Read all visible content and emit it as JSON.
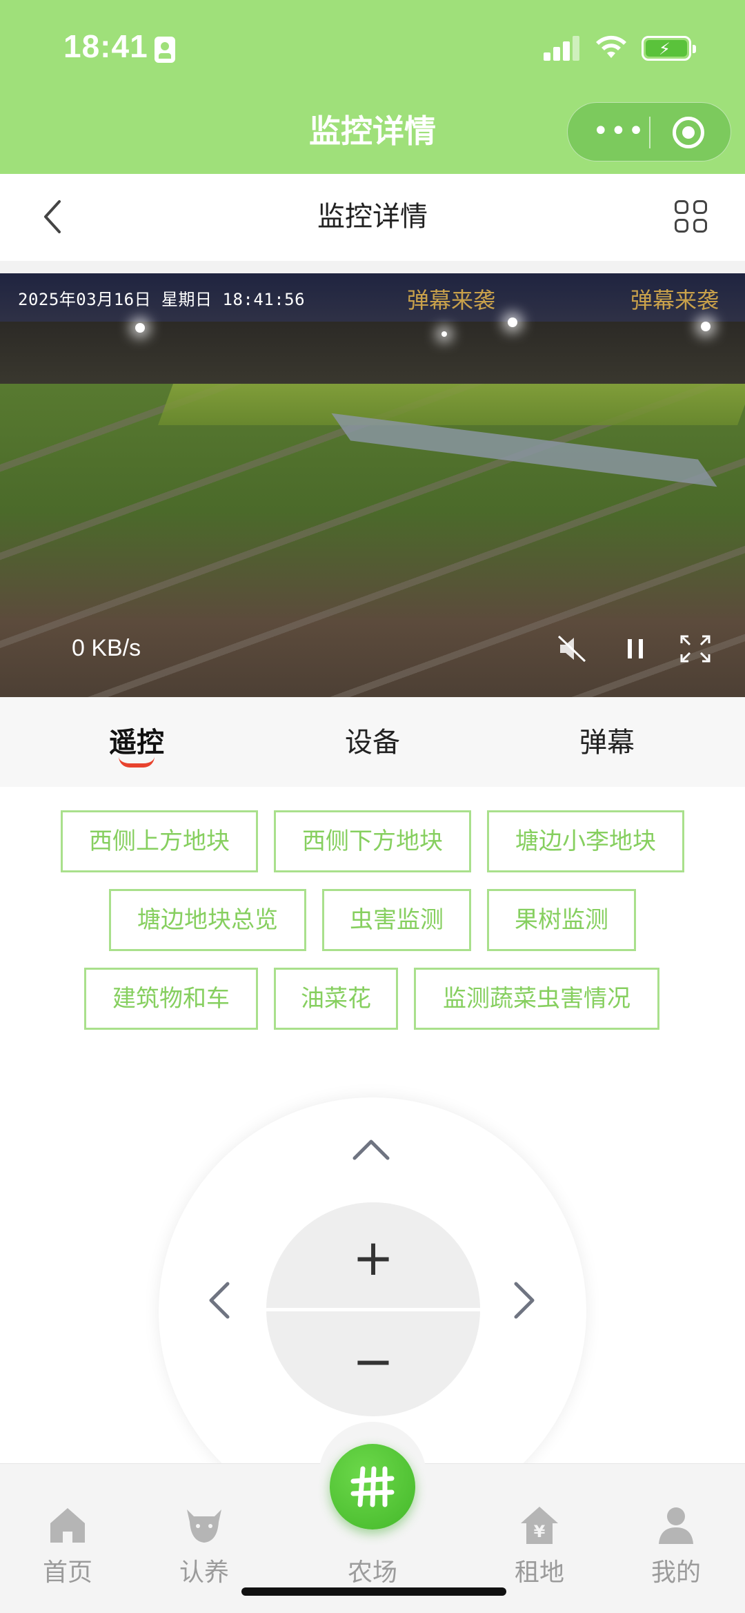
{
  "status_bar": {
    "time": "18:41"
  },
  "miniprogram": {
    "title": "监控详情",
    "capsule_more_icon": "more-dots-icon",
    "capsule_close_icon": "target-circle-icon"
  },
  "header": {
    "title": "监控详情",
    "back_icon": "chevron-left-icon",
    "menu_icon": "grid-four-icon"
  },
  "video": {
    "timestamp": "2025年03月16日  星期日  18:41:56",
    "danmu": [
      "弹幕来袭",
      "弹幕来袭"
    ],
    "speed": "0 KB/s"
  },
  "tabs": [
    {
      "label": "遥控",
      "active": true
    },
    {
      "label": "设备",
      "active": false
    },
    {
      "label": "弹幕",
      "active": false
    }
  ],
  "presets": [
    "西侧上方地块",
    "西侧下方地块",
    "塘边小李地块",
    "塘边地块总览",
    "虫害监测",
    "果树监测",
    "建筑物和车",
    "油菜花",
    "监测蔬菜虫害情况"
  ],
  "remote": {
    "zoom_in": "+",
    "zoom_out": "−"
  },
  "tabbar": [
    {
      "label": "首页",
      "icon": "home-icon"
    },
    {
      "label": "认养",
      "icon": "cow-icon"
    },
    {
      "label": "农场",
      "icon": "farm-grid-icon"
    },
    {
      "label": "租地",
      "icon": "house-yen-icon"
    },
    {
      "label": "我的",
      "icon": "user-icon"
    }
  ],
  "colors": {
    "header_green": "#9fe07a",
    "preset_border": "#a9e08c",
    "preset_text": "#86cf5f",
    "tab_underline": "#e8432e",
    "farm_button": "#44b82a"
  }
}
